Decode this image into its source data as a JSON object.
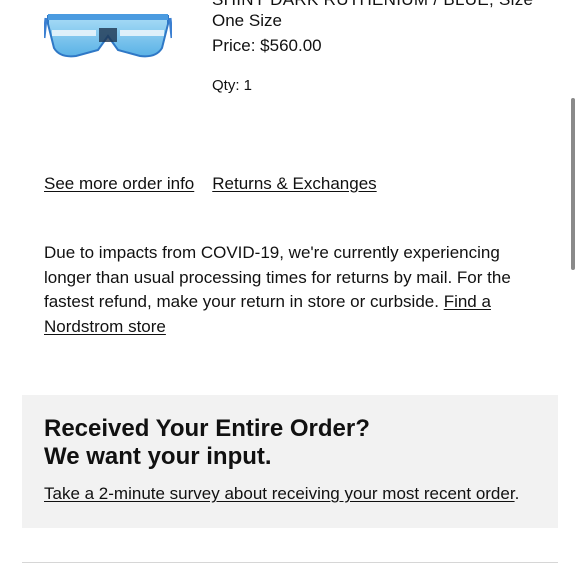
{
  "product": {
    "image_alt": "blue shield sunglasses",
    "truncated_line": "SHINY DARK RUTHENIUM / BLUE, Size",
    "size": "One Size",
    "price": "Price: $560.00",
    "qty": "Qty: 1"
  },
  "links": {
    "order_info": "See more order info",
    "returns": "Returns & Exchanges"
  },
  "notice": {
    "text": "Due to impacts from COVID-19, we're currently experiencing longer than usual processing times for returns by mail. For the fastest refund, make your return in store or curbside. ",
    "link": "Find a Nordstrom store"
  },
  "survey": {
    "heading_line1": "Received Your Entire Order?",
    "heading_line2": "We want your input.",
    "link": "Take a 2-minute survey about receiving your most recent order",
    "suffix": "."
  },
  "colors": {
    "lens": "#7ec8f0",
    "frame": "#3b7fd1",
    "panel": "#f2f2f2"
  }
}
